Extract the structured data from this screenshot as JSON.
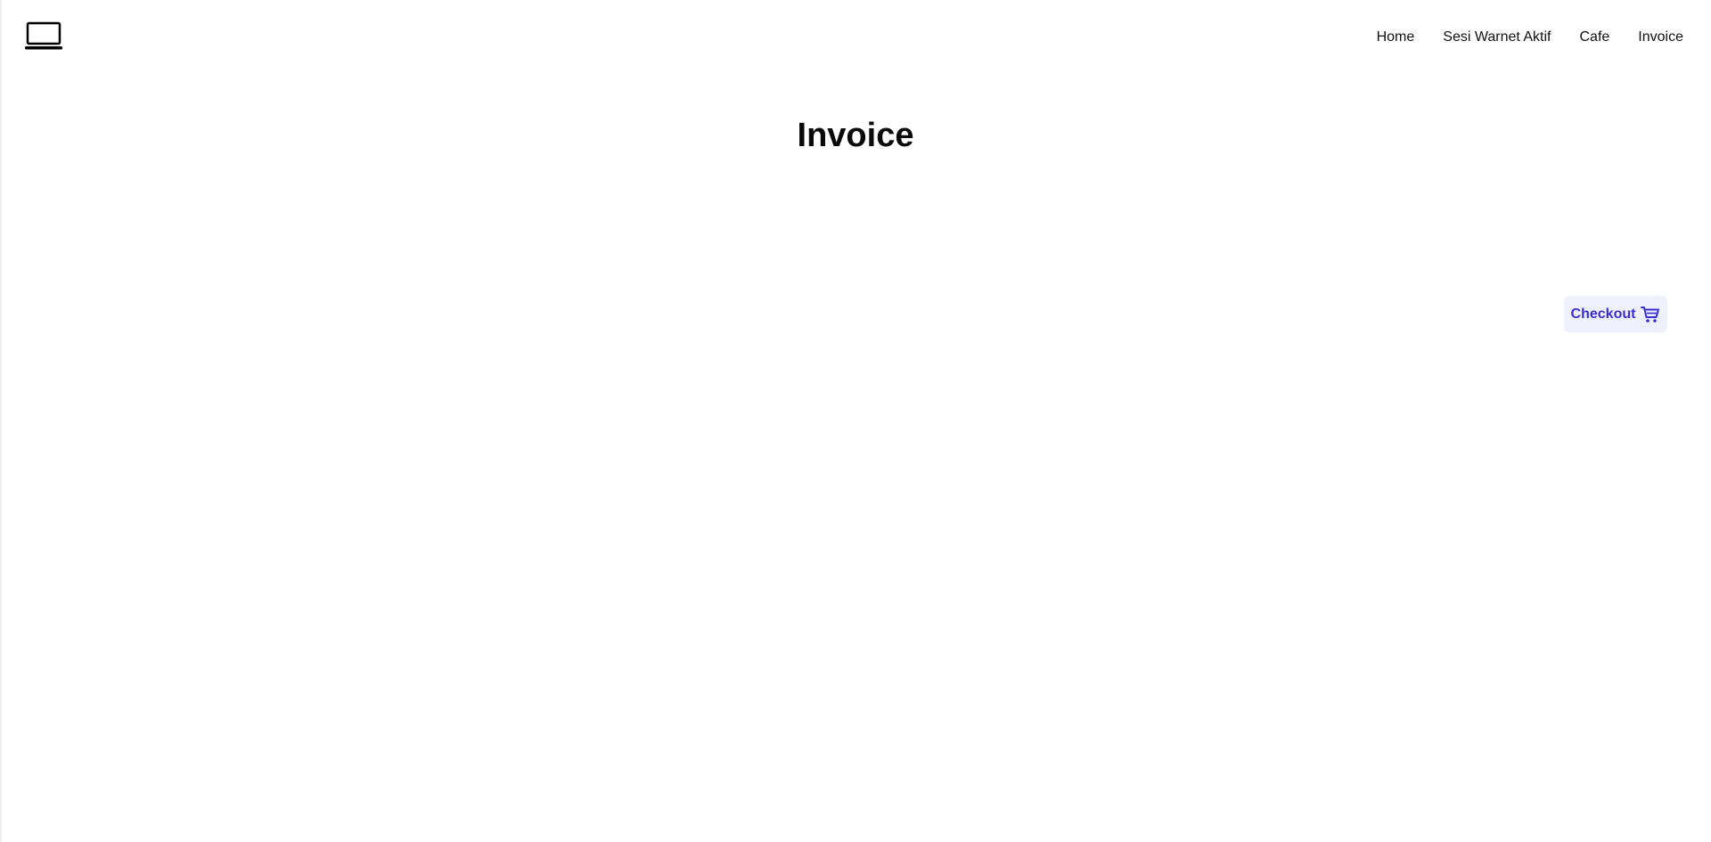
{
  "navbar": {
    "logo_icon": "laptop-icon",
    "links": [
      {
        "label": "Home"
      },
      {
        "label": "Sesi Warnet Aktif"
      },
      {
        "label": "Cafe"
      },
      {
        "label": "Invoice"
      }
    ]
  },
  "main": {
    "title": "Invoice",
    "checkout": {
      "label": "Checkout",
      "icon": "cart-icon",
      "accent_color": "#3b2fd4",
      "background_color": "#eef0fb"
    }
  }
}
